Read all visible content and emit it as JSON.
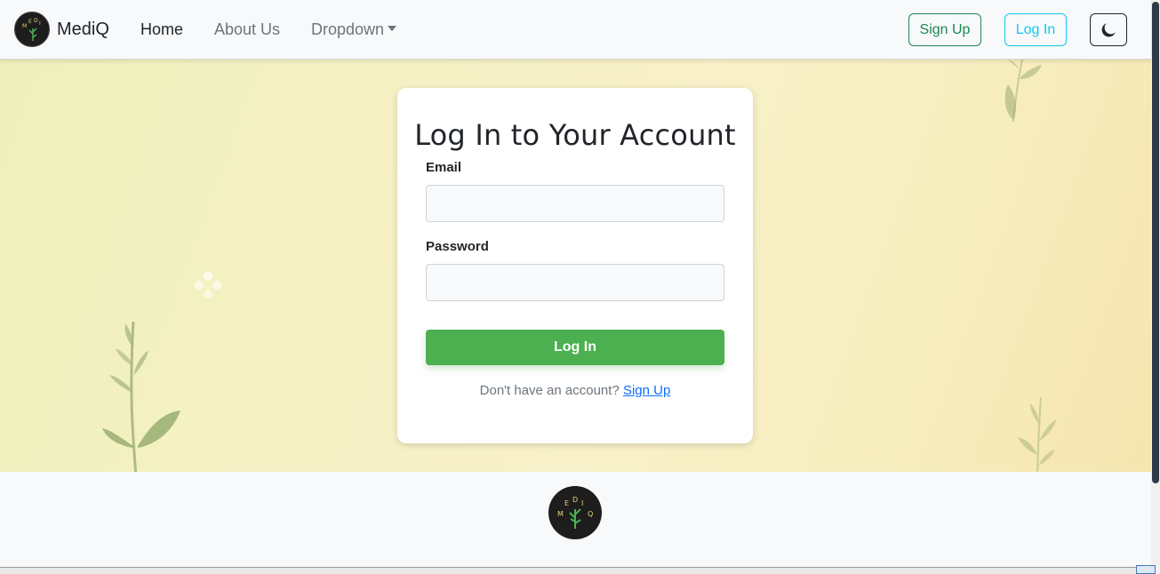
{
  "navbar": {
    "brand": "MediQ",
    "links": [
      {
        "label": "Home",
        "active": true
      },
      {
        "label": "About Us",
        "active": false
      },
      {
        "label": "Dropdown",
        "active": false
      }
    ],
    "signup_label": "Sign Up",
    "login_label": "Log In",
    "theme_icon": "moon-icon"
  },
  "login_card": {
    "title": "Log In to Your Account",
    "email_label": "Email",
    "email_value": "",
    "password_label": "Password",
    "password_value": "",
    "submit_label": "Log In",
    "signup_prompt": "Don't have an account?",
    "signup_link": "Sign Up"
  },
  "colors": {
    "signup_outline": "#198754",
    "login_outline": "#0dcaf0",
    "submit_bg": "#4cb050",
    "link": "#0d6efd"
  }
}
